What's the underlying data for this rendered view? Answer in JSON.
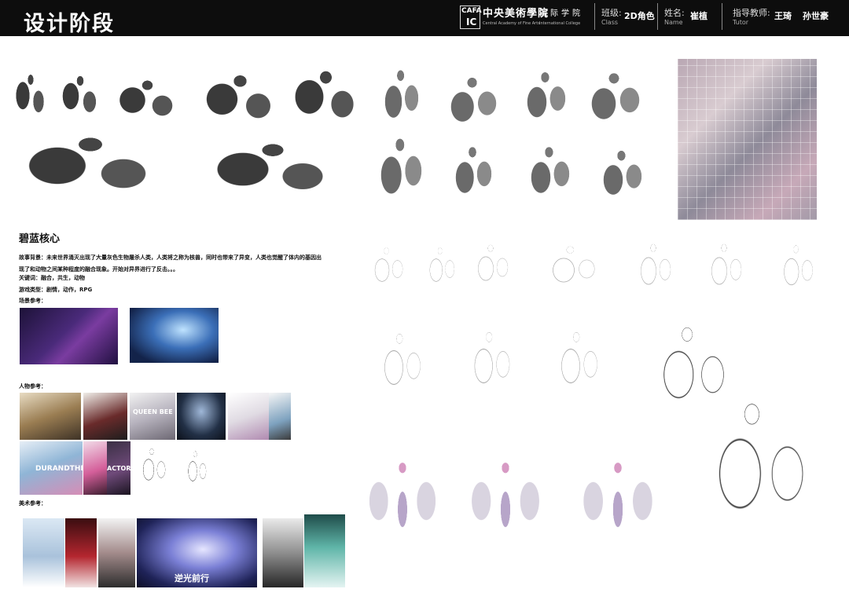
{
  "header": {
    "title": "设计阶段",
    "logo": {
      "line1": "CAFA",
      "line2": "IC"
    },
    "school": {
      "cn": "中央美術學院",
      "en": "Central Academy of Fine Arts"
    },
    "college": {
      "cn": "国际学院",
      "en": "International College"
    },
    "class": {
      "label": "班级:",
      "sub": "Class",
      "value": "2D角色"
    },
    "name": {
      "label": "姓名:",
      "sub": "Name",
      "value": "崔植"
    },
    "tutor": {
      "label": "指导教师:",
      "sub": "Tutor",
      "value1": "王琦",
      "value2": "孙世豪"
    }
  },
  "project": {
    "title": "碧蓝核心",
    "story_line1": "故事背景：未来世界涌灭出现了大量灰色生物屠杀人类，人类将之称为核兽，同时也带来了异变，人类也觉醒了体内的基因出",
    "story_line2": "现了和动物之间某种程度的融合现象。开始对异界进行了反击。。。",
    "keywords": "关键词：融合，共生，动物",
    "game_type": "游戏类型：剧情，动作，RPG",
    "scene_ref_label": "场景参考：",
    "character_ref_label": "人物参考：",
    "art_ref_label": "美术参考："
  },
  "reference_image_text": {
    "queen_bee": "QUEEN BEE",
    "durandal": "DURANDTHEM",
    "actor": "ACTOR",
    "poster_title": "逆光前行"
  }
}
